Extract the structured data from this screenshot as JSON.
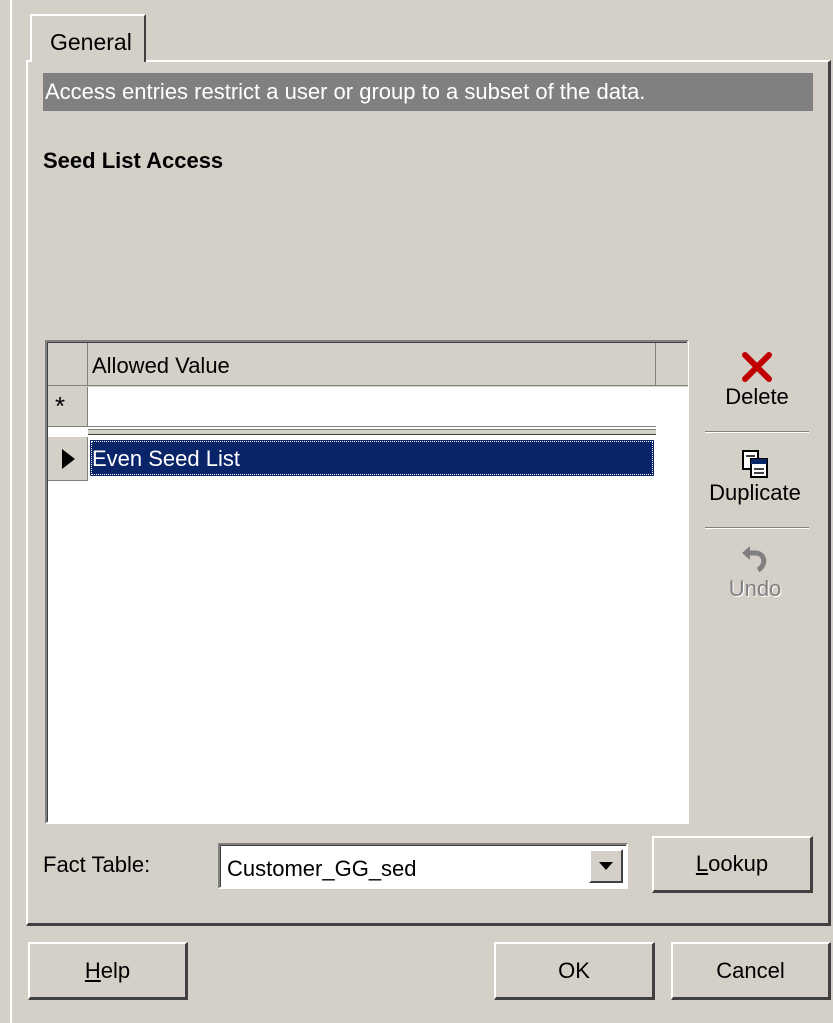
{
  "tab": {
    "label": "General"
  },
  "info": {
    "text": "Access entries restrict a user or group to a subset of the data."
  },
  "section": {
    "title": "Seed List Access"
  },
  "grid": {
    "column_header": "Allowed Value",
    "new_row_marker": "*",
    "rows": [
      {
        "value": "Even Seed List",
        "selected": true
      }
    ]
  },
  "side_buttons": {
    "delete": {
      "label": "Delete",
      "icon": "x-icon",
      "color": "#c00000"
    },
    "duplicate": {
      "label": "Duplicate",
      "icon": "copy-icon"
    },
    "undo": {
      "label": "Undo",
      "icon": "undo-icon",
      "enabled": false
    }
  },
  "fact_table": {
    "label": "Fact Table:",
    "value": "Customer_GG_sed",
    "lookup_label": "ookup",
    "lookup_mnemonic": "L"
  },
  "footer": {
    "help_mnemonic": "H",
    "help_rest": "elp",
    "ok_label": "OK",
    "cancel_label": "Cancel"
  },
  "colors": {
    "dialog_bg": "#d4d0c8",
    "info_bar_bg": "#808080",
    "selection_bg": "#0a246a"
  }
}
